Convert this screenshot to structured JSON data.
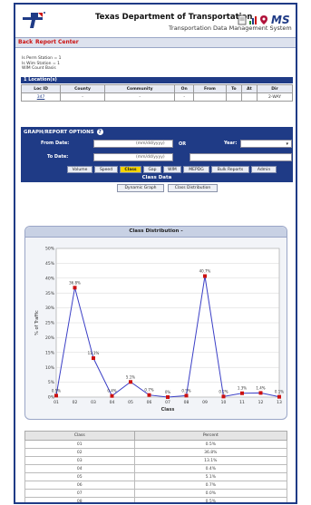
{
  "header": {
    "title": "Texas Department of Transportation",
    "subtitle": "Transportation Data Management System"
  },
  "nav": {
    "back": "Back",
    "report_center": "Report Center"
  },
  "info_lines": [
    "Is Perm Station = 1",
    "Is Wim Station = 1",
    "WIM Count Basis"
  ],
  "locations": {
    "bar_title": "1 Location(s)",
    "columns": [
      "Loc ID",
      "County",
      "Community",
      "On",
      "From",
      "To",
      "At",
      "Dir"
    ],
    "rows": [
      [
        "347",
        "-",
        "-",
        "-",
        "",
        "",
        "",
        "2-WAY"
      ]
    ]
  },
  "options": {
    "bar_title": "GRAPH/REPORT OPTIONS",
    "from_label": "From Date:",
    "to_label": "To Date:",
    "date_placeholder": "(mm/dd/yyyy)",
    "or_label": "OR",
    "year_label": "Year:",
    "tabs": [
      "Volume",
      "Speed",
      "Class",
      "Gap",
      "WIM",
      "MEPDG",
      "Bulk Reports",
      "Admin"
    ],
    "active_tab": "Class",
    "section_title": "Class Data",
    "buttons": [
      "Dynamic Graph",
      "Class Distribution"
    ]
  },
  "chart_panel_title": "Class Distribution -",
  "chart_data": {
    "type": "line",
    "title": "",
    "xlabel": "Class",
    "ylabel": "% of Traffic",
    "categories": [
      "01",
      "02",
      "03",
      "04",
      "05",
      "06",
      "07",
      "08",
      "09",
      "10",
      "11",
      "12",
      "13"
    ],
    "values": [
      0.5,
      36.8,
      13.1,
      0.4,
      5.1,
      0.7,
      0.0,
      0.5,
      40.7,
      0.2,
      1.3,
      1.4,
      0.1
    ],
    "value_labels": [
      "0.5%",
      "36.8%",
      "13.1%",
      "0.4%",
      "5.1%",
      "0.7%",
      "0%",
      "0.5%",
      "40.7%",
      "0.2%",
      "1.3%",
      "1.4%",
      "0.1%"
    ],
    "y_ticks": [
      "0%",
      "5%",
      "10%",
      "15%",
      "20%",
      "25%",
      "30%",
      "35%",
      "40%",
      "45%",
      "50%"
    ],
    "ylim": [
      0,
      50
    ],
    "grid": true,
    "line_color": "#3b3fc6",
    "marker_color": "#cc1111"
  },
  "percent_table": {
    "columns": [
      "Class",
      "Percent"
    ],
    "rows": [
      [
        "01",
        "0.5%"
      ],
      [
        "02",
        "36.8%"
      ],
      [
        "03",
        "13.1%"
      ],
      [
        "04",
        "0.4%"
      ],
      [
        "05",
        "5.1%"
      ],
      [
        "06",
        "0.7%"
      ],
      [
        "07",
        "0.0%"
      ],
      [
        "08",
        "0.5%"
      ]
    ]
  }
}
